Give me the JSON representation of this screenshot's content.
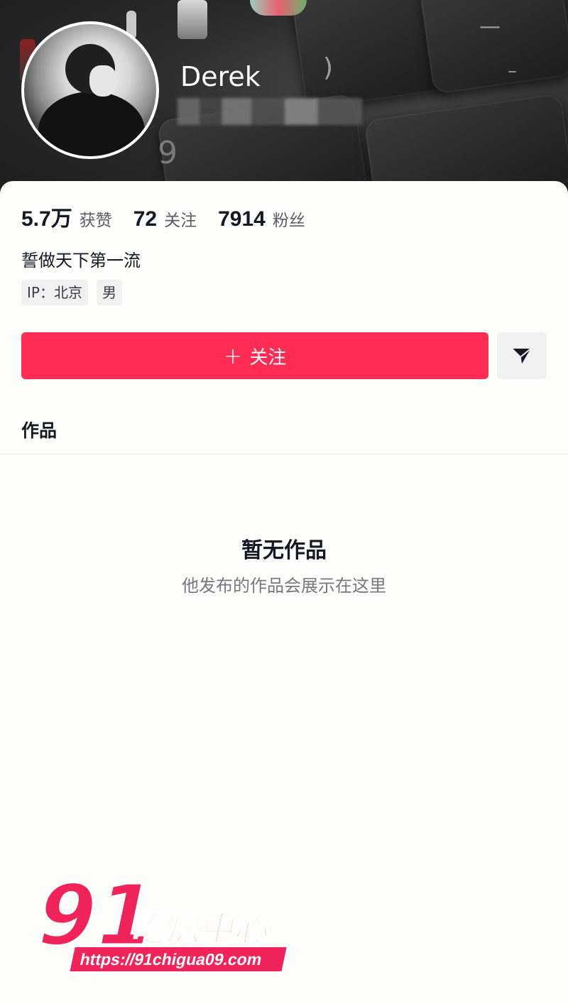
{
  "profile": {
    "username": "Derek",
    "bio": "誓做天下第一流",
    "ip_tag": "IP：北京",
    "gender_tag": "男"
  },
  "stats": [
    {
      "value": "5.7万",
      "label": "获赞"
    },
    {
      "value": "72",
      "label": "关注"
    },
    {
      "value": "7914",
      "label": "粉丝"
    }
  ],
  "actions": {
    "follow_label": "关注",
    "follow_icon": "plus-icon",
    "message_icon": "send-icon"
  },
  "tabs": {
    "works_label": "作品"
  },
  "empty_state": {
    "title": "暂无作品",
    "subtitle": "他发布的作品会展示在这里"
  },
  "watermark": {
    "number": "91",
    "name": "吃瓜中心",
    "url": "https://91chigua09.com"
  },
  "colors": {
    "accent": "#fe2c55",
    "text_primary": "#161823",
    "text_secondary": "#77777f"
  }
}
